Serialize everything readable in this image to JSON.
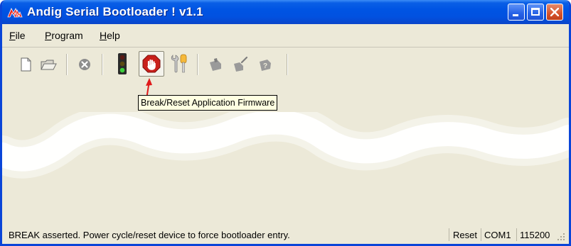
{
  "window": {
    "title": "Andig Serial Bootloader !  v1.1",
    "titlebar_color": "#0054e3"
  },
  "menu": {
    "items": [
      {
        "label": "File",
        "accel": "F"
      },
      {
        "label": "Program",
        "accel": "P"
      },
      {
        "label": "Help",
        "accel": "H"
      }
    ]
  },
  "toolbar": {
    "buttons": [
      {
        "icon": "new-file-icon",
        "enabled": true
      },
      {
        "icon": "open-folder-icon",
        "enabled": true
      },
      {
        "icon": "stop-icon",
        "enabled": true
      },
      {
        "icon": "traffic-light-icon",
        "enabled": true
      },
      {
        "icon": "break-reset-hand-icon",
        "enabled": true,
        "pressed": true
      },
      {
        "icon": "settings-tools-icon",
        "enabled": true
      },
      {
        "icon": "write-icon",
        "enabled": false
      },
      {
        "icon": "verify-icon",
        "enabled": false
      },
      {
        "icon": "query-icon",
        "enabled": false
      }
    ]
  },
  "tooltip": {
    "text": "Break/Reset Application Firmware"
  },
  "statusbar": {
    "message": "BREAK asserted. Power cycle/reset device to force bootloader entry.",
    "state": "Reset",
    "port": "COM1",
    "baud": "115200"
  }
}
